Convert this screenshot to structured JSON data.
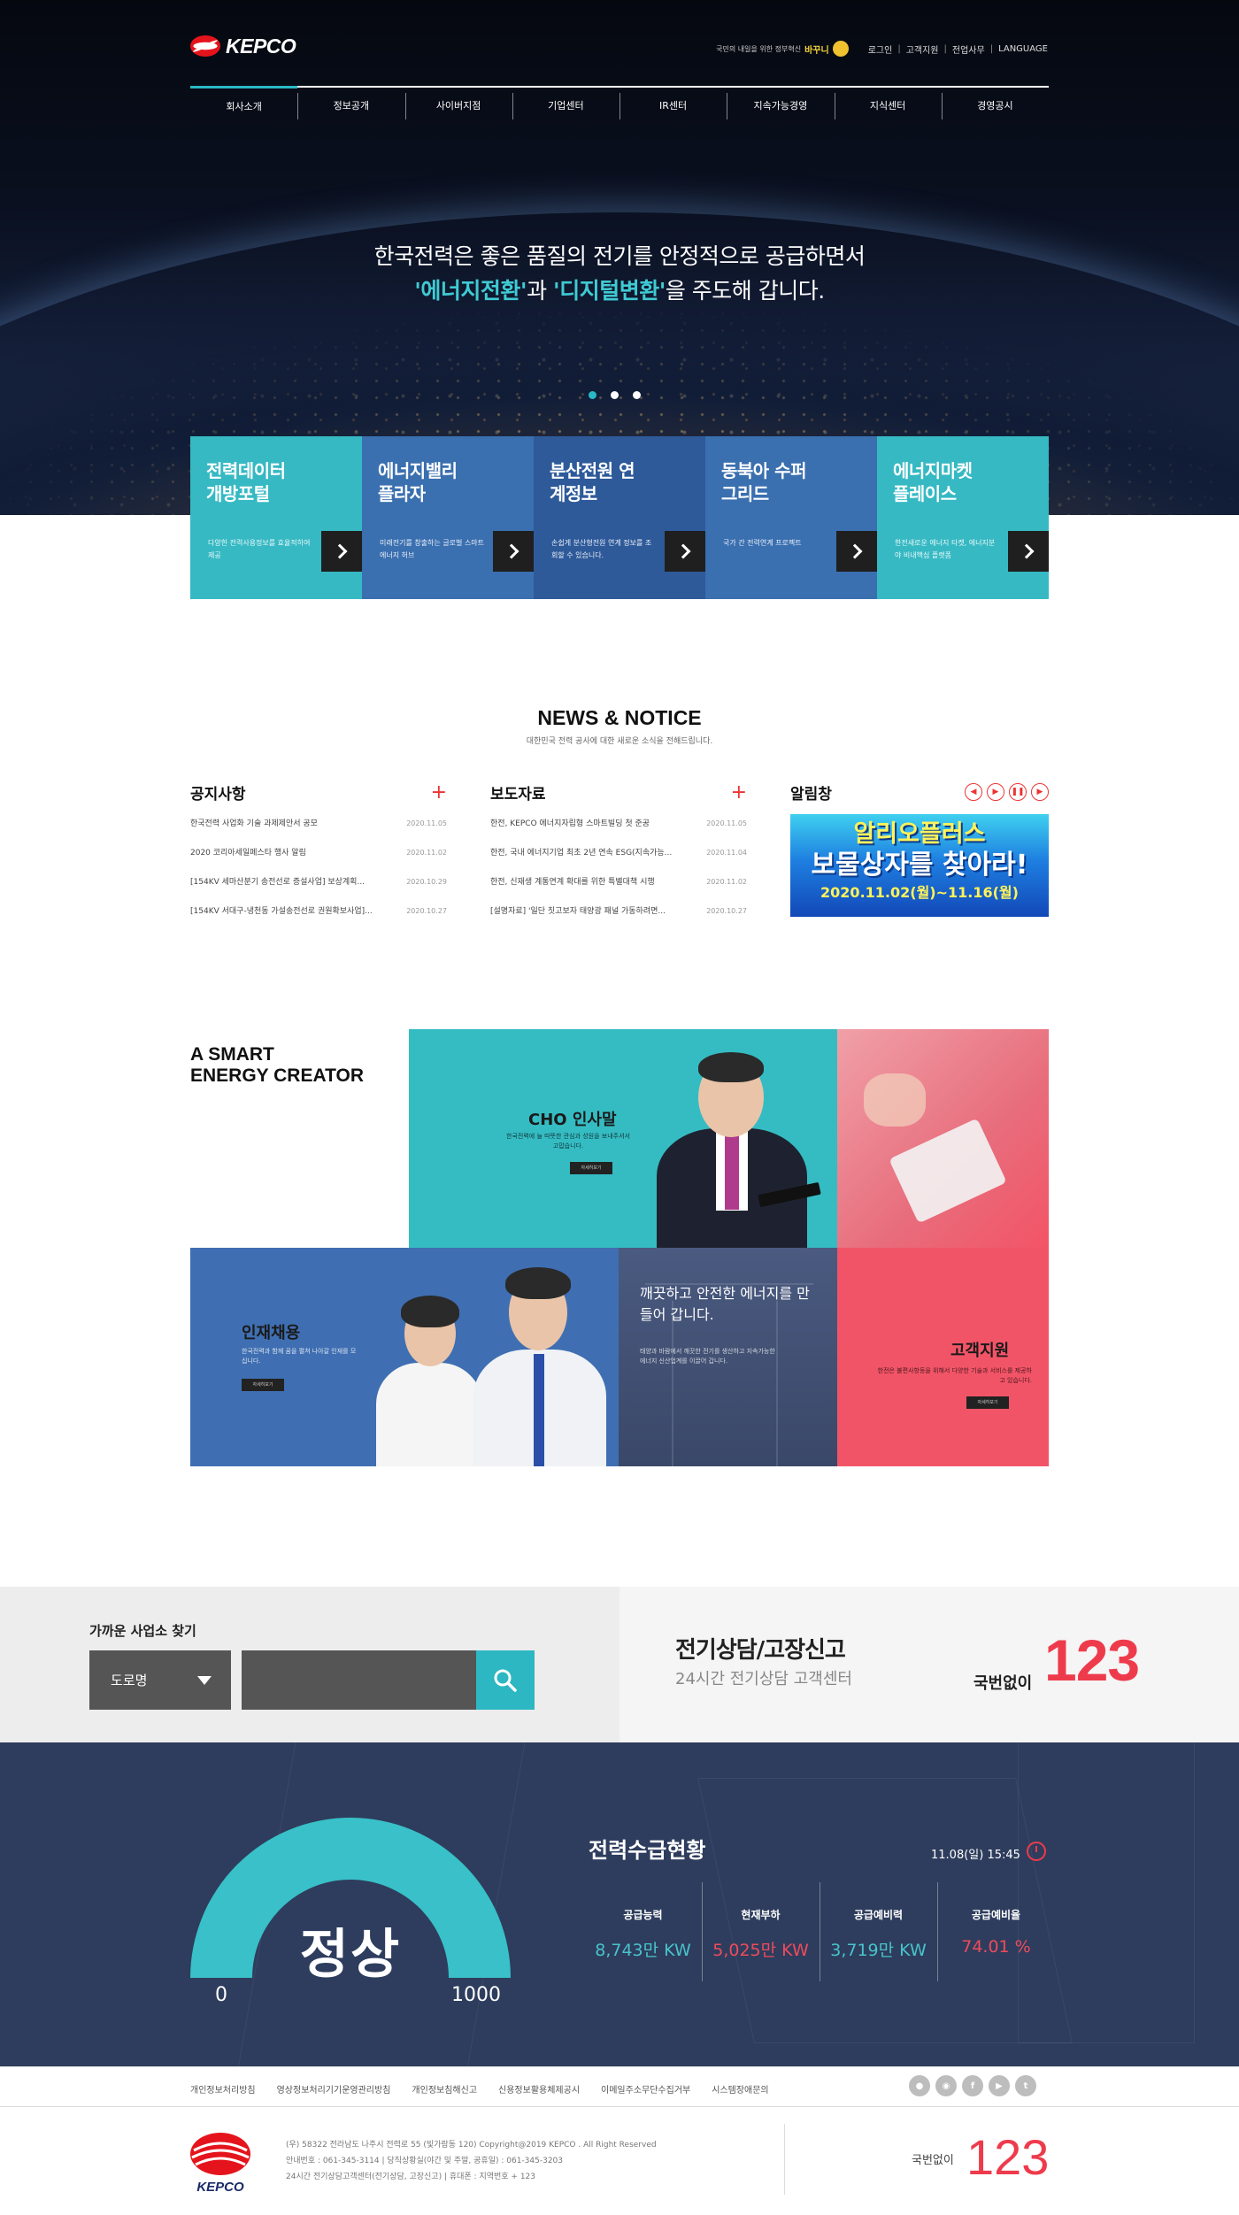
{
  "brand": {
    "name": "KEPCO",
    "footer_name": "KEPCO"
  },
  "top_util": {
    "slogan_prefix": "국민의 내일을 위한 정부혁신",
    "slogan_highlight": "바꾸니",
    "links": [
      "로그인",
      "고객지원",
      "전업사무",
      "LANGUAGE"
    ]
  },
  "gnb": [
    "회사소개",
    "정보공개",
    "사이버지점",
    "기업센터",
    "IR센터",
    "지속가능경영",
    "지식센터",
    "경영공시"
  ],
  "hero": {
    "line1": "한국전력은 좋은 품질의 전기를 안정적으로 공급하면서",
    "hl1": "'에너지전환'",
    "mid": "과 ",
    "hl2": "'디지털변환'",
    "tail": "을 주도해 갑니다."
  },
  "quick_links": [
    {
      "title": "전력데이터 개방포털",
      "desc": "다양한 전력사용정보를 효율적하여 제공",
      "color": "#36b9c3"
    },
    {
      "title": "에너지밸리 플라자",
      "desc": "미래전기를 창출하는 글로벌 스마트 에너지 허브",
      "color": "#3a6fb0"
    },
    {
      "title": "분산전원 연계정보",
      "desc": "손쉽게 분산형전원 연계 정보를 조회할 수 있습니다.",
      "color": "#2e5a9a"
    },
    {
      "title": "동북아 수퍼그리드",
      "desc": "국가 간 전력연계 프로젝트",
      "color": "#3a6fb0"
    },
    {
      "title": "에너지마켓 플레이스",
      "desc": "한전새로운 에너지 타켓, 에너지분야 비내핵심 플랫폼",
      "color": "#36b9c3"
    }
  ],
  "news": {
    "title": "NEWS & NOTICE",
    "subtitle": "대한민국 전력 공사에 대한 새로운 소식을 전해드립니다.",
    "notice": {
      "title": "공지사항",
      "items": [
        {
          "text": "한국전력 사업화 기술 과제제안서 공모",
          "date": "2020.11.05"
        },
        {
          "text": "2020 코리아세일페스타 행사 알림",
          "date": "2020.11.02"
        },
        {
          "text": "[154KV 세마산분기 송전선로 증설사업] 보상계획...",
          "date": "2020.10.29"
        },
        {
          "text": "[154KV 서대구-냉천동 가설송전선로 권원확보사업]...",
          "date": "2020.10.27"
        }
      ]
    },
    "press": {
      "title": "보도자료",
      "items": [
        {
          "text": "한전, KEPCO 에너지자립형 스마트빌딩 첫 준공",
          "date": "2020.11.05"
        },
        {
          "text": "한전, 국내 에너지기업 최초 2년 연속 ESG(지속가능...",
          "date": "2020.11.04"
        },
        {
          "text": "한전, 신재생 계통연계 확대를 위한 특별대책 시행",
          "date": "2020.11.02"
        },
        {
          "text": "[설명자료] '일단 짓고보자 태양광 패널 가동하려면...",
          "date": "2020.10.27"
        }
      ]
    },
    "popup": {
      "title": "알림창",
      "banner_l1": "알리오플러스",
      "banner_l2": "보물상자를 찾아라!",
      "banner_l3": "2020.11.02(월)~11.16(월)"
    }
  },
  "smart": {
    "title_l1": "A SMART",
    "title_l2": "ENERGY CREATOR",
    "ceo": {
      "title": "CHO 인사말",
      "desc": "한국전력에 늘 따뜻한 관심과 성원을 보내주셔서 고맙습니다.",
      "btn": "자세히보기"
    },
    "recruit": {
      "title": "인재채용",
      "desc": "한국전력과 함께 꿈을 펼쳐 나아갈 인재를 모십니다.",
      "btn": "자세히보기"
    },
    "safe": {
      "title": "깨끗하고 안전한 에너지를 만들어 갑니다.",
      "desc": "태양과 바람에서 깨끗한 전기를 생산하고 지속가능한 에너지 신산업계를 이끌어 갑니다."
    },
    "support": {
      "title": "고객지원",
      "desc": "한전은 불편사항등을 위해서 다양한 기술과 서비스를 제공하고 있습니다.",
      "btn": "자세히보기"
    }
  },
  "cs": {
    "branch_label": "가까운 사업소 찾기",
    "region": "도로명",
    "title": "전기상담/고장신고",
    "subtitle": "24시간 전기상담 고객센터",
    "prefix": "국번없이",
    "number": "123"
  },
  "power": {
    "status": "정상",
    "min": "0",
    "max": "1000",
    "title": "전력수급현황",
    "time": "11.08(일) 15:45",
    "stats": [
      {
        "label": "공급능력",
        "value": "8,743만 KW",
        "color": "#48c3cc"
      },
      {
        "label": "현재부하",
        "value": "5,025만 KW",
        "color": "#ee4b5c"
      },
      {
        "label": "공급예비력",
        "value": "3,719만 KW",
        "color": "#48c3cc"
      },
      {
        "label": "공급예비율",
        "value": "74.01 %",
        "color": "#ee4b5c"
      }
    ]
  },
  "footer": {
    "links": [
      "개인정보처리방침",
      "영상정보처리기기운영관리방침",
      "개인정보침해신고",
      "신용정보활용체제공시",
      "이메일주소무단수집거부",
      "시스템장애문의"
    ],
    "social": [
      "talk-icon",
      "instagram-icon",
      "facebook-icon",
      "youtube-icon",
      "twitter-icon"
    ],
    "addr1": "(우) 58322 전라남도 나주시 전력로 55 (빛가람동 120) Copyright@2019 KEPCO . All Right Reserved",
    "addr2": "안내번호 : 061-345-3114    |    당직상황실(야간 및 주말, 공휴일) : 061-345-3203",
    "addr3": "24시간 전기상담고객센터(전기상담, 고장신고)    |    휴대폰 : 지역번호 + 123",
    "prefix": "국번없이",
    "number": "123"
  }
}
